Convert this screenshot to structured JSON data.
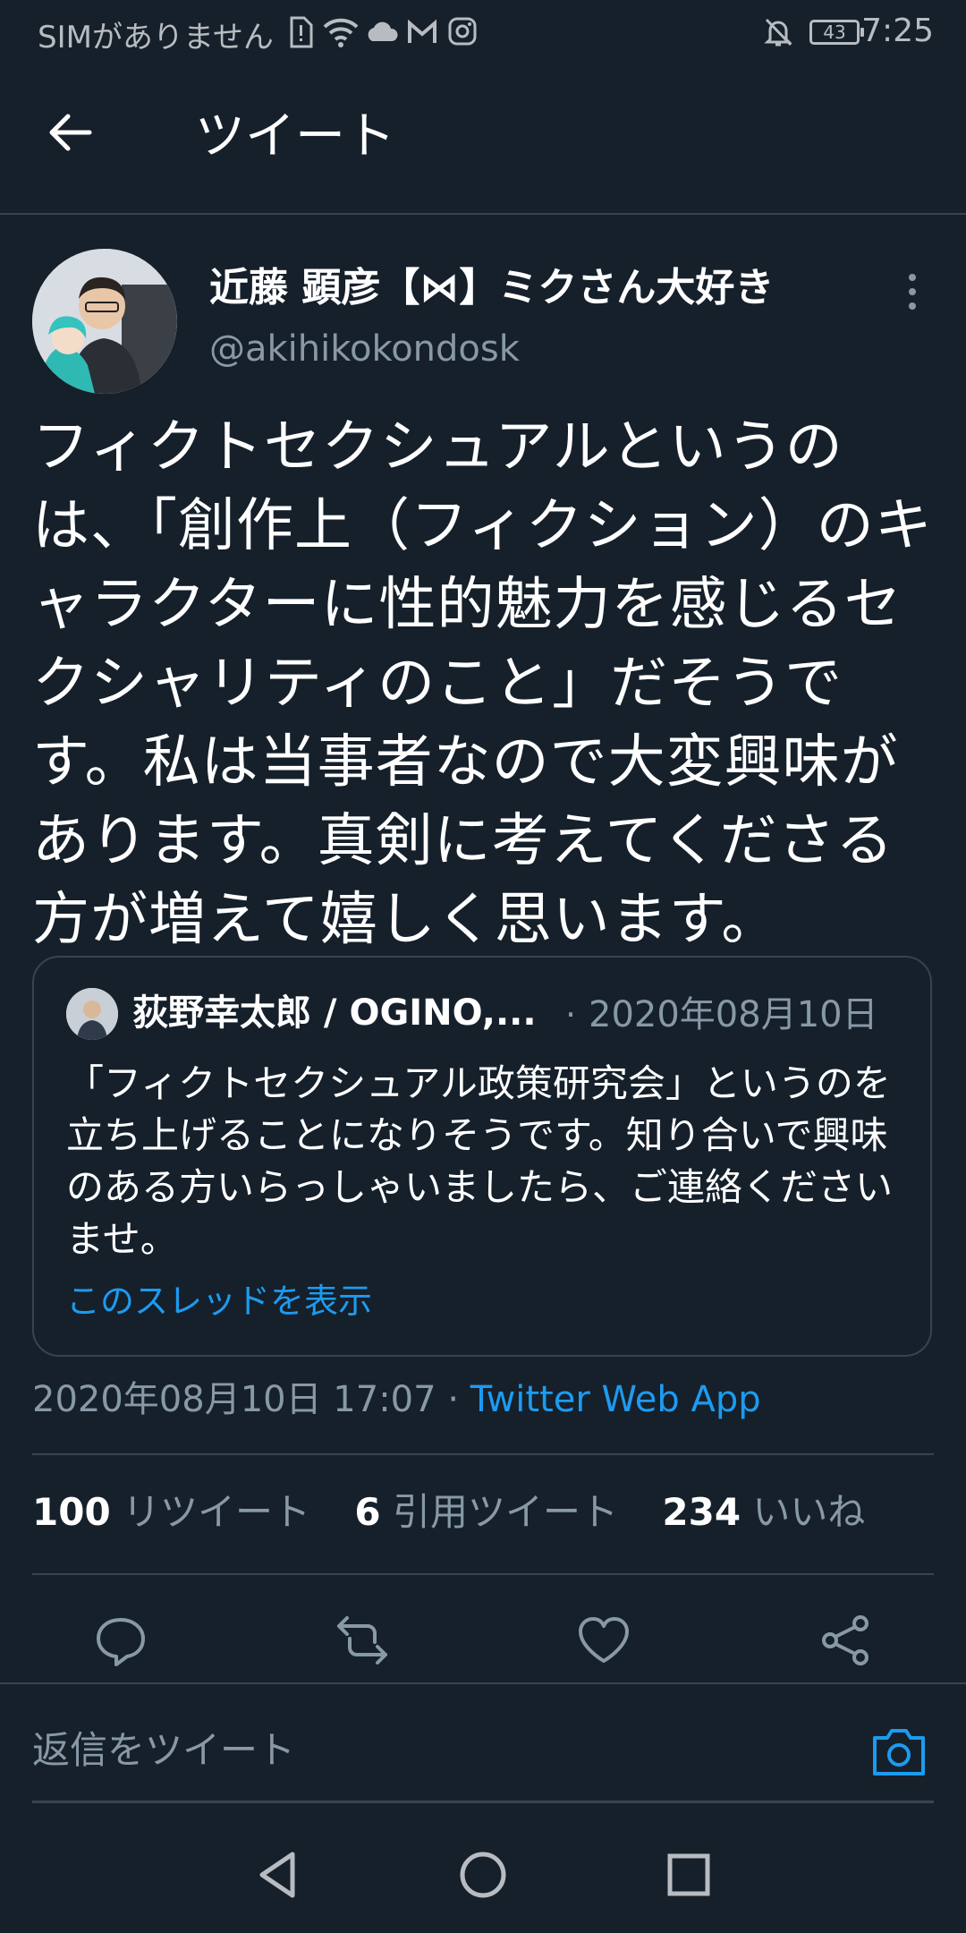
{
  "status_bar": {
    "carrier": "SIMがありません",
    "battery": "43",
    "time": "7:25"
  },
  "header": {
    "title": "ツイート"
  },
  "tweet": {
    "author_name": "近藤 顕彦【⋈】ミクさん大好き",
    "author_handle": "@akihikokondosk",
    "text": "フィクトセクシュアルというのは、「創作上（フィクション）のキャラクターに性的魅力を感じるセクシャリティのこと」だそうです。私は当事者なので大変興味があります。真剣に考えてくださる方が増えて嬉しく思います。",
    "timestamp": "2020年08月10日 17:07",
    "separator": "·",
    "source": "Twitter Web App"
  },
  "quoted_tweet": {
    "author_name": "荻野幸太郎 / OGINO,...",
    "dot": "·",
    "date": "2020年08月10日",
    "text": "「フィクトセクシュアル政策研究会」というのを立ち上げることになりそうです。知り合いで興味のある方いらっしゃいましたら、ご連絡くださいませ。",
    "thread_link": "このスレッドを表示"
  },
  "stats": {
    "retweets_count": "100",
    "retweets_label": "リツイート",
    "quotes_count": "6",
    "quotes_label": "引用ツイート",
    "likes_count": "234",
    "likes_label": "いいね"
  },
  "actions": [
    "reply-icon",
    "retweet-icon",
    "like-icon",
    "share-icon"
  ],
  "reply": {
    "placeholder": "返信をツイート"
  },
  "colors": {
    "background": "#15202b",
    "accent": "#1d9bf0",
    "secondary_text": "#8899a6",
    "divider": "#38444d"
  }
}
